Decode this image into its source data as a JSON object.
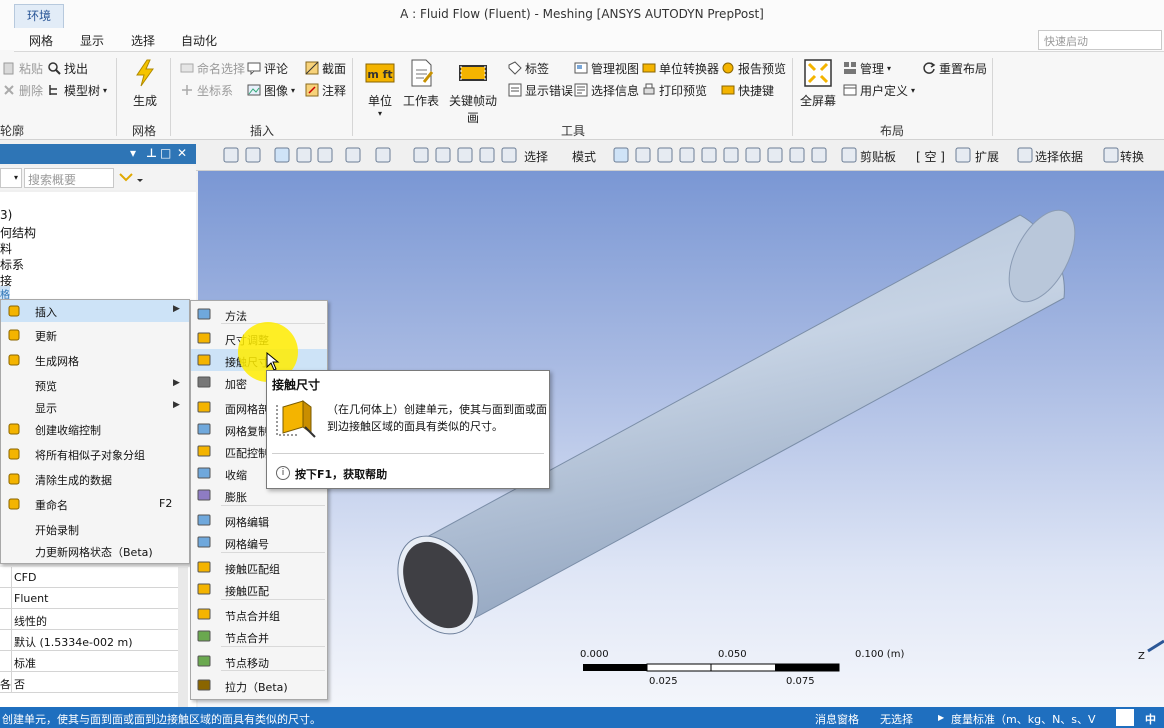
{
  "window": {
    "context_tab": "环境",
    "title": "A : Fluid Flow (Fluent) - Meshing [ANSYS AUTODYN PrepPost]"
  },
  "ribbon_tabs": [
    "网格",
    "显示",
    "选择",
    "自动化"
  ],
  "quick_search_placeholder": "快速启动",
  "ribbon": {
    "outline_group": {
      "label": "轮廓",
      "items": [
        "粘贴",
        "删除",
        "找出",
        "模型树"
      ]
    },
    "mesh_group": {
      "label": "网格",
      "generate": "生成"
    },
    "insert_group": {
      "label": "插入",
      "items": [
        "命名选择",
        "坐标系",
        "评论",
        "图像",
        "截面",
        "注释"
      ]
    },
    "tools_group": {
      "label": "工具",
      "big_buttons": [
        "单位",
        "工作表",
        "关键帧动画"
      ],
      "items": [
        "标签",
        "显示错误",
        "管理视图",
        "选择信息",
        "单位转换器",
        "打印预览",
        "报告预览",
        "快捷键"
      ]
    },
    "layout_group": {
      "label": "布局",
      "fullscreen": "全屏幕",
      "items": [
        "管理",
        "用户定义",
        "重置布局"
      ]
    }
  },
  "toolbar": {
    "select_label": "选择",
    "mode_label": "模式",
    "clipboard_label": "剪贴板",
    "empty_label": "[ 空 ]",
    "extend_label": "扩展",
    "select_by_label": "选择依据",
    "convert_label": "转换"
  },
  "outline": {
    "search_placeholder": "搜索概要",
    "tree_lines": [
      "3)",
      "何结构",
      "料",
      "标系",
      "接",
      "格"
    ]
  },
  "context_menu": {
    "items": [
      {
        "label": "插入",
        "arrow": true,
        "highlight": true
      },
      {
        "label": "更新",
        "arrow": false
      },
      {
        "label": "生成网格",
        "arrow": false
      },
      {
        "label": "预览",
        "arrow": true
      },
      {
        "label": "显示",
        "arrow": true
      },
      {
        "label": "创建收缩控制",
        "arrow": false
      },
      {
        "label": "将所有相似子对象分组",
        "arrow": false
      },
      {
        "label": "清除生成的数据",
        "arrow": false
      },
      {
        "label": "重命名",
        "arrow": false,
        "shortcut": "F2"
      },
      {
        "label": "开始录制",
        "arrow": false
      },
      {
        "label": "力更新网格状态（Beta)",
        "arrow": false
      }
    ]
  },
  "submenu": {
    "items": [
      "方法",
      "尺寸调整",
      "接触尺寸",
      "加密",
      "面网格剖分",
      "网格复制",
      "匹配控制",
      "收缩",
      "膨胀",
      "网格编辑",
      "网格编号",
      "接触匹配组",
      "接触匹配",
      "节点合并组",
      "节点合并",
      "节点移动",
      "拉力（Beta)"
    ]
  },
  "tooltip": {
    "title": "接触尺寸",
    "body": "（在几何体上）创建单元，使其与面到面或面到边接触区域的面具有类似的尺寸。",
    "help": "按下F1，获取帮助"
  },
  "details": {
    "rows": [
      {
        "key": "",
        "value": "CFD"
      },
      {
        "key": "",
        "value": "Fluent"
      },
      {
        "key": "",
        "value": "线性的"
      },
      {
        "key": "",
        "value": "默认 (1.5334e-002 m)"
      },
      {
        "key": "",
        "value": "标准"
      },
      {
        "key": "各",
        "value": "否"
      }
    ]
  },
  "scale_bar": {
    "top_labels": [
      "0.000",
      "0.050",
      "0.100 (m)"
    ],
    "bottom_labels": [
      "0.025",
      "0.075"
    ]
  },
  "triad_label": "Z",
  "statusbar": {
    "message": "创建单元，使其与面到面或面到边接触区域的面具有类似的尺寸。",
    "messages_pane": "消息窗格",
    "selection": "无选择",
    "units": "度量标准（m、kg、N、s、V",
    "ime": "中"
  },
  "colors": {
    "accent_blue": "#2e75b6",
    "statusbar_blue": "#1f6fbf",
    "highlight": "#cde3f7",
    "pipe": "#aebfd6"
  }
}
